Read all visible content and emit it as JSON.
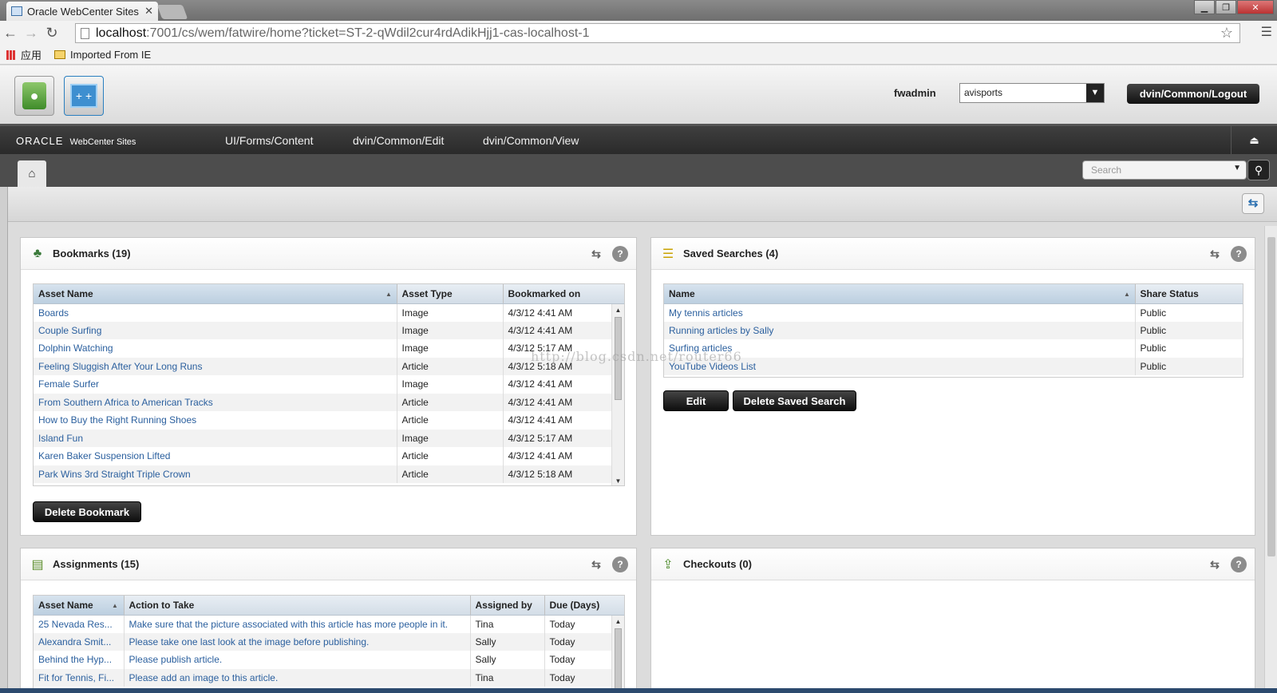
{
  "browser": {
    "tab_title": "Oracle WebCenter Sites",
    "url_host": "localhost",
    "url_path": ":7001/cs/wem/fatwire/home?ticket=ST-2-qWdil2cur4rdAdikHjj1-cas-localhost-1",
    "bookmarks_bar": {
      "apps_label": "应用",
      "folder_label": "Imported From IE"
    }
  },
  "header": {
    "username": "fwadmin",
    "site_selected": "avisports",
    "logout_label": "dvin/Common/Logout"
  },
  "navbar": {
    "brand_oracle": "ORACLE",
    "brand_product": "WebCenter Sites",
    "items": [
      "UI/Forms/Content",
      "dvin/Common/Edit",
      "dvin/Common/View"
    ]
  },
  "search": {
    "placeholder": "Search"
  },
  "bookmarks": {
    "title": "Bookmarks (19)",
    "columns": [
      "Asset Name",
      "Asset Type",
      "Bookmarked on"
    ],
    "rows": [
      [
        "Boards",
        "Image",
        "4/3/12 4:41 AM"
      ],
      [
        "Couple Surfing",
        "Image",
        "4/3/12 4:41 AM"
      ],
      [
        "Dolphin Watching",
        "Image",
        "4/3/12 5:17 AM"
      ],
      [
        "Feeling Sluggish After Your Long Runs",
        "Article",
        "4/3/12 5:18 AM"
      ],
      [
        "Female Surfer",
        "Image",
        "4/3/12 4:41 AM"
      ],
      [
        "From Southern Africa to American Tracks",
        "Article",
        "4/3/12 4:41 AM"
      ],
      [
        "How to Buy the Right Running Shoes",
        "Article",
        "4/3/12 4:41 AM"
      ],
      [
        "Island Fun",
        "Image",
        "4/3/12 5:17 AM"
      ],
      [
        "Karen Baker Suspension Lifted",
        "Article",
        "4/3/12 4:41 AM"
      ],
      [
        "Park Wins 3rd Straight Triple Crown",
        "Article",
        "4/3/12 5:18 AM"
      ]
    ],
    "delete_label": "Delete Bookmark"
  },
  "saved_searches": {
    "title": "Saved Searches (4)",
    "columns": [
      "Name",
      "Share Status"
    ],
    "rows": [
      [
        "My tennis articles",
        "Public"
      ],
      [
        "Running articles by Sally",
        "Public"
      ],
      [
        "Surfing articles",
        "Public"
      ],
      [
        "YouTube Videos List",
        "Public"
      ]
    ],
    "edit_label": "Edit",
    "delete_label": "Delete Saved Search"
  },
  "assignments": {
    "title": "Assignments (15)",
    "columns": [
      "Asset Name",
      "Action to Take",
      "Assigned by",
      "Due (Days)"
    ],
    "rows": [
      [
        "25 Nevada Res...",
        "Make sure that the picture associated with this article has more people in it.",
        "Tina",
        "Today"
      ],
      [
        "Alexandra Smit...",
        "Please take one last look at the image before publishing.",
        "Sally",
        "Today"
      ],
      [
        "Behind the Hyp...",
        "Please publish article.",
        "Sally",
        "Today"
      ],
      [
        "Fit for Tennis, Fi...",
        "Please add an image to this article.",
        "Tina",
        "Today"
      ]
    ]
  },
  "checkouts": {
    "title": "Checkouts (0)"
  },
  "watermark": "http://blog.csdn.net/router66",
  "colors": {
    "link": "#2a5f9e",
    "navbar": "#2f2f2f"
  }
}
